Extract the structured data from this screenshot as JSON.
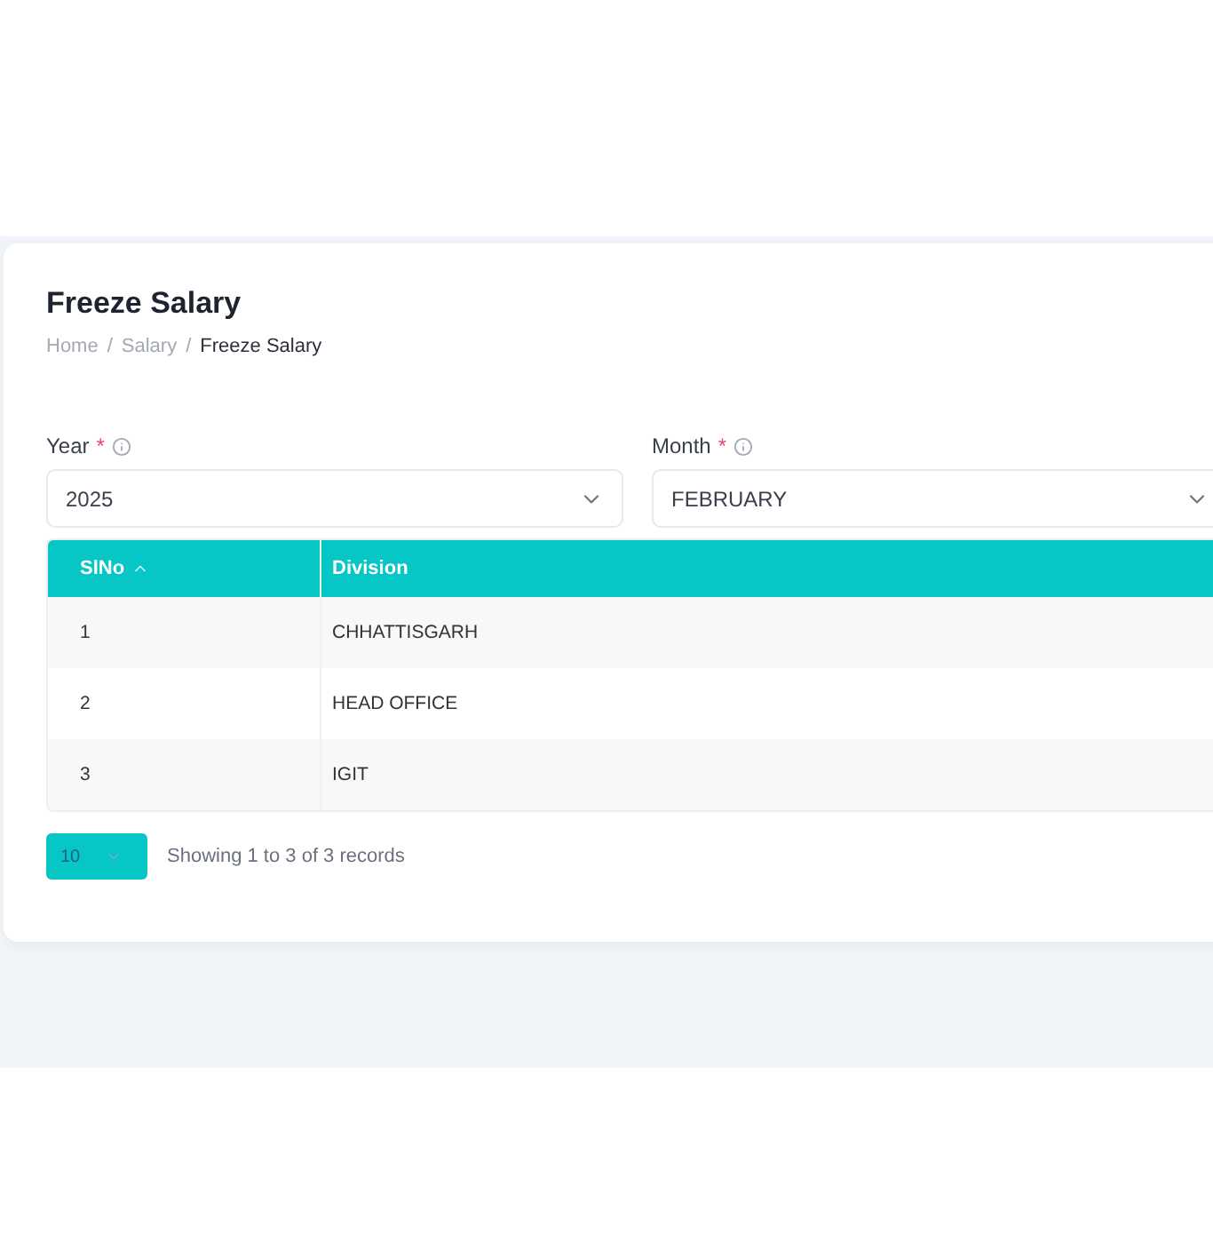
{
  "page": {
    "title": "Freeze Salary",
    "breadcrumb": [
      {
        "label": "Home",
        "current": false
      },
      {
        "label": "Salary",
        "current": false
      },
      {
        "label": "Freeze Salary",
        "current": true
      }
    ],
    "separator": "/"
  },
  "filters": [
    {
      "label": "Year",
      "required_mark": "*",
      "value": "2025"
    },
    {
      "label": "Month",
      "required_mark": "*",
      "value": "FEBRUARY"
    }
  ],
  "table": {
    "columns": [
      {
        "label": "SlNo",
        "sorted": true
      },
      {
        "label": "Division",
        "sorted": false
      }
    ],
    "rows": [
      [
        "1",
        "CHHATTISGARH"
      ],
      [
        "2",
        "HEAD OFFICE"
      ],
      [
        "3",
        "IGIT"
      ]
    ]
  },
  "footer": {
    "page_size": "10",
    "summary": "Showing 1 to 3 of 3 records"
  }
}
